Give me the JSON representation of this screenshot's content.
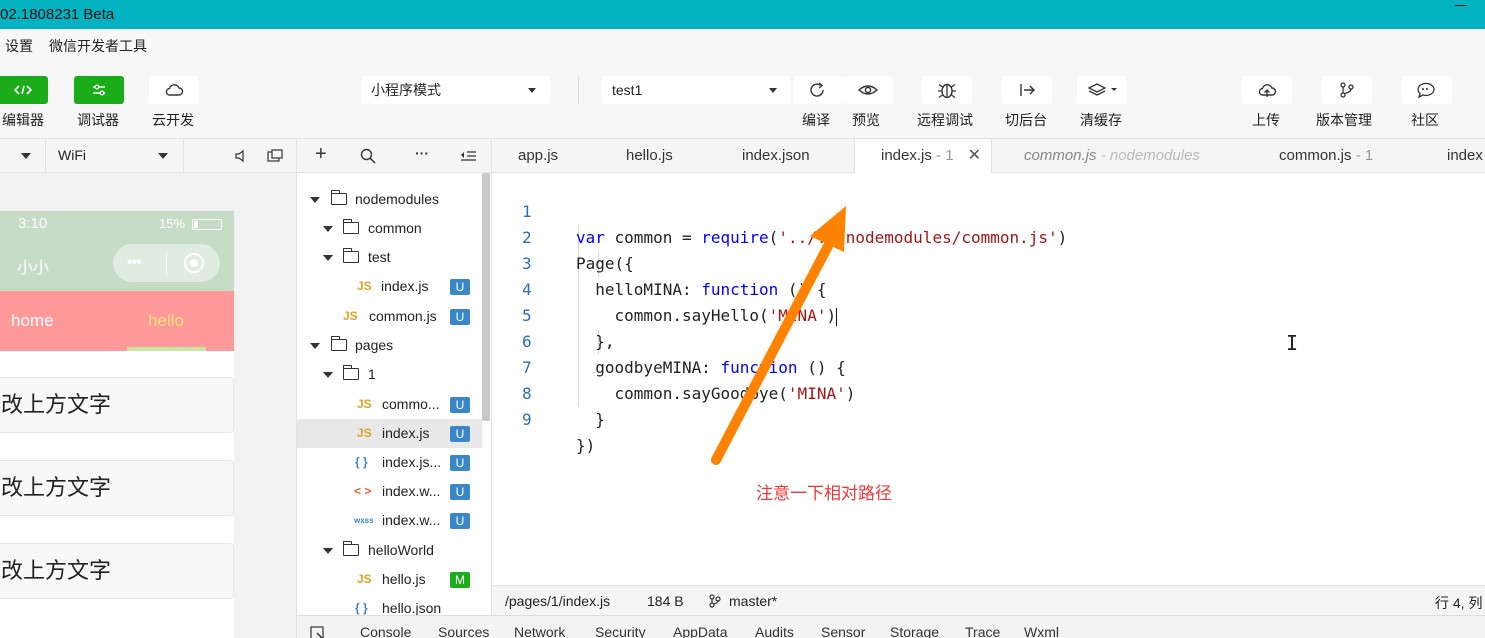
{
  "titlebar": {
    "title": "02.1808231 Beta"
  },
  "menu": {
    "items": [
      "设置",
      "微信开发者工具"
    ]
  },
  "toolbar": {
    "editor": "编辑器",
    "debugger": "调试器",
    "cloud": "云开发",
    "mode_select": "小程序模式",
    "compile_select": "test1",
    "compile": "编译",
    "preview": "预览",
    "remote_debug": "远程调试",
    "background": "切后台",
    "clear_cache": "清缓存",
    "upload": "上传",
    "version": "版本管理",
    "community": "社区",
    "accent": "#1aad19"
  },
  "simulator": {
    "network": "WiFi",
    "time": "3:10",
    "battery": "15%",
    "nav_title": "小小",
    "tabs": [
      "home",
      "hello"
    ],
    "cards": [
      "改上方文字",
      "改上方文字",
      "改上方文字"
    ]
  },
  "tree": {
    "items": [
      {
        "name": "nodemodules"
      },
      {
        "name": "common"
      },
      {
        "name": "test"
      },
      {
        "name": "index.js",
        "badge": "U",
        "icon": "JS"
      },
      {
        "name": "common.js",
        "badge": "U",
        "icon": "JS"
      },
      {
        "name": "pages"
      },
      {
        "name": "1"
      },
      {
        "name": "commo...",
        "badge": "U",
        "icon": "JS"
      },
      {
        "name": "index.js",
        "badge": "U",
        "icon": "JS"
      },
      {
        "name": "index.js...",
        "badge": "U",
        "icon": "{ }"
      },
      {
        "name": "index.w...",
        "badge": "U",
        "icon": "< >"
      },
      {
        "name": "index.w...",
        "badge": "U",
        "icon": "wxss"
      },
      {
        "name": "helloWorld"
      },
      {
        "name": "hello.js",
        "badge": "M",
        "icon": "JS"
      },
      {
        "name": "hello.json",
        "icon": "{ }"
      }
    ]
  },
  "tabs": [
    {
      "label": "app.js"
    },
    {
      "label": "hello.js"
    },
    {
      "label": "index.json"
    },
    {
      "label": "index.js",
      "suffix": " - 1"
    },
    {
      "label": "common.js",
      "suffix": " - nodemodules"
    },
    {
      "label": "common.js",
      "suffix": " - 1"
    },
    {
      "label": "index"
    }
  ],
  "code": {
    "line_numbers": [
      "1",
      "2",
      "3",
      "4",
      "5",
      "6",
      "7",
      "8",
      "9"
    ],
    "l1": {
      "kw": "var",
      "a": " common = ",
      "fn": "require",
      "b": "(",
      "str": "'../../nodemodules/common.js'",
      "c": ")"
    },
    "l2": "Page({",
    "l3": {
      "a": "  helloMINA: ",
      "kw": "function",
      "b": " () {"
    },
    "l4": {
      "a": "    common.sayHello(",
      "str": "'MINA'",
      "b": ")"
    },
    "l5": "  },",
    "l6": {
      "a": "  goodbyeMINA: ",
      "kw": "function",
      "b": " () {"
    },
    "l7": {
      "a": "    common.sayGoodbye(",
      "str": "'MINA'",
      "b": ")"
    },
    "l8": "  }",
    "l9": "})"
  },
  "annotation": "注意一下相对路径",
  "statusbar": {
    "path": "/pages/1/index.js",
    "size": "184 B",
    "branch": "master*",
    "position": "行 4, 列"
  },
  "devtools": {
    "tabs": [
      "Console",
      "Sources",
      "Network",
      "Security",
      "AppData",
      "Audits",
      "Sensor",
      "Storage",
      "Trace",
      "Wxml"
    ]
  }
}
